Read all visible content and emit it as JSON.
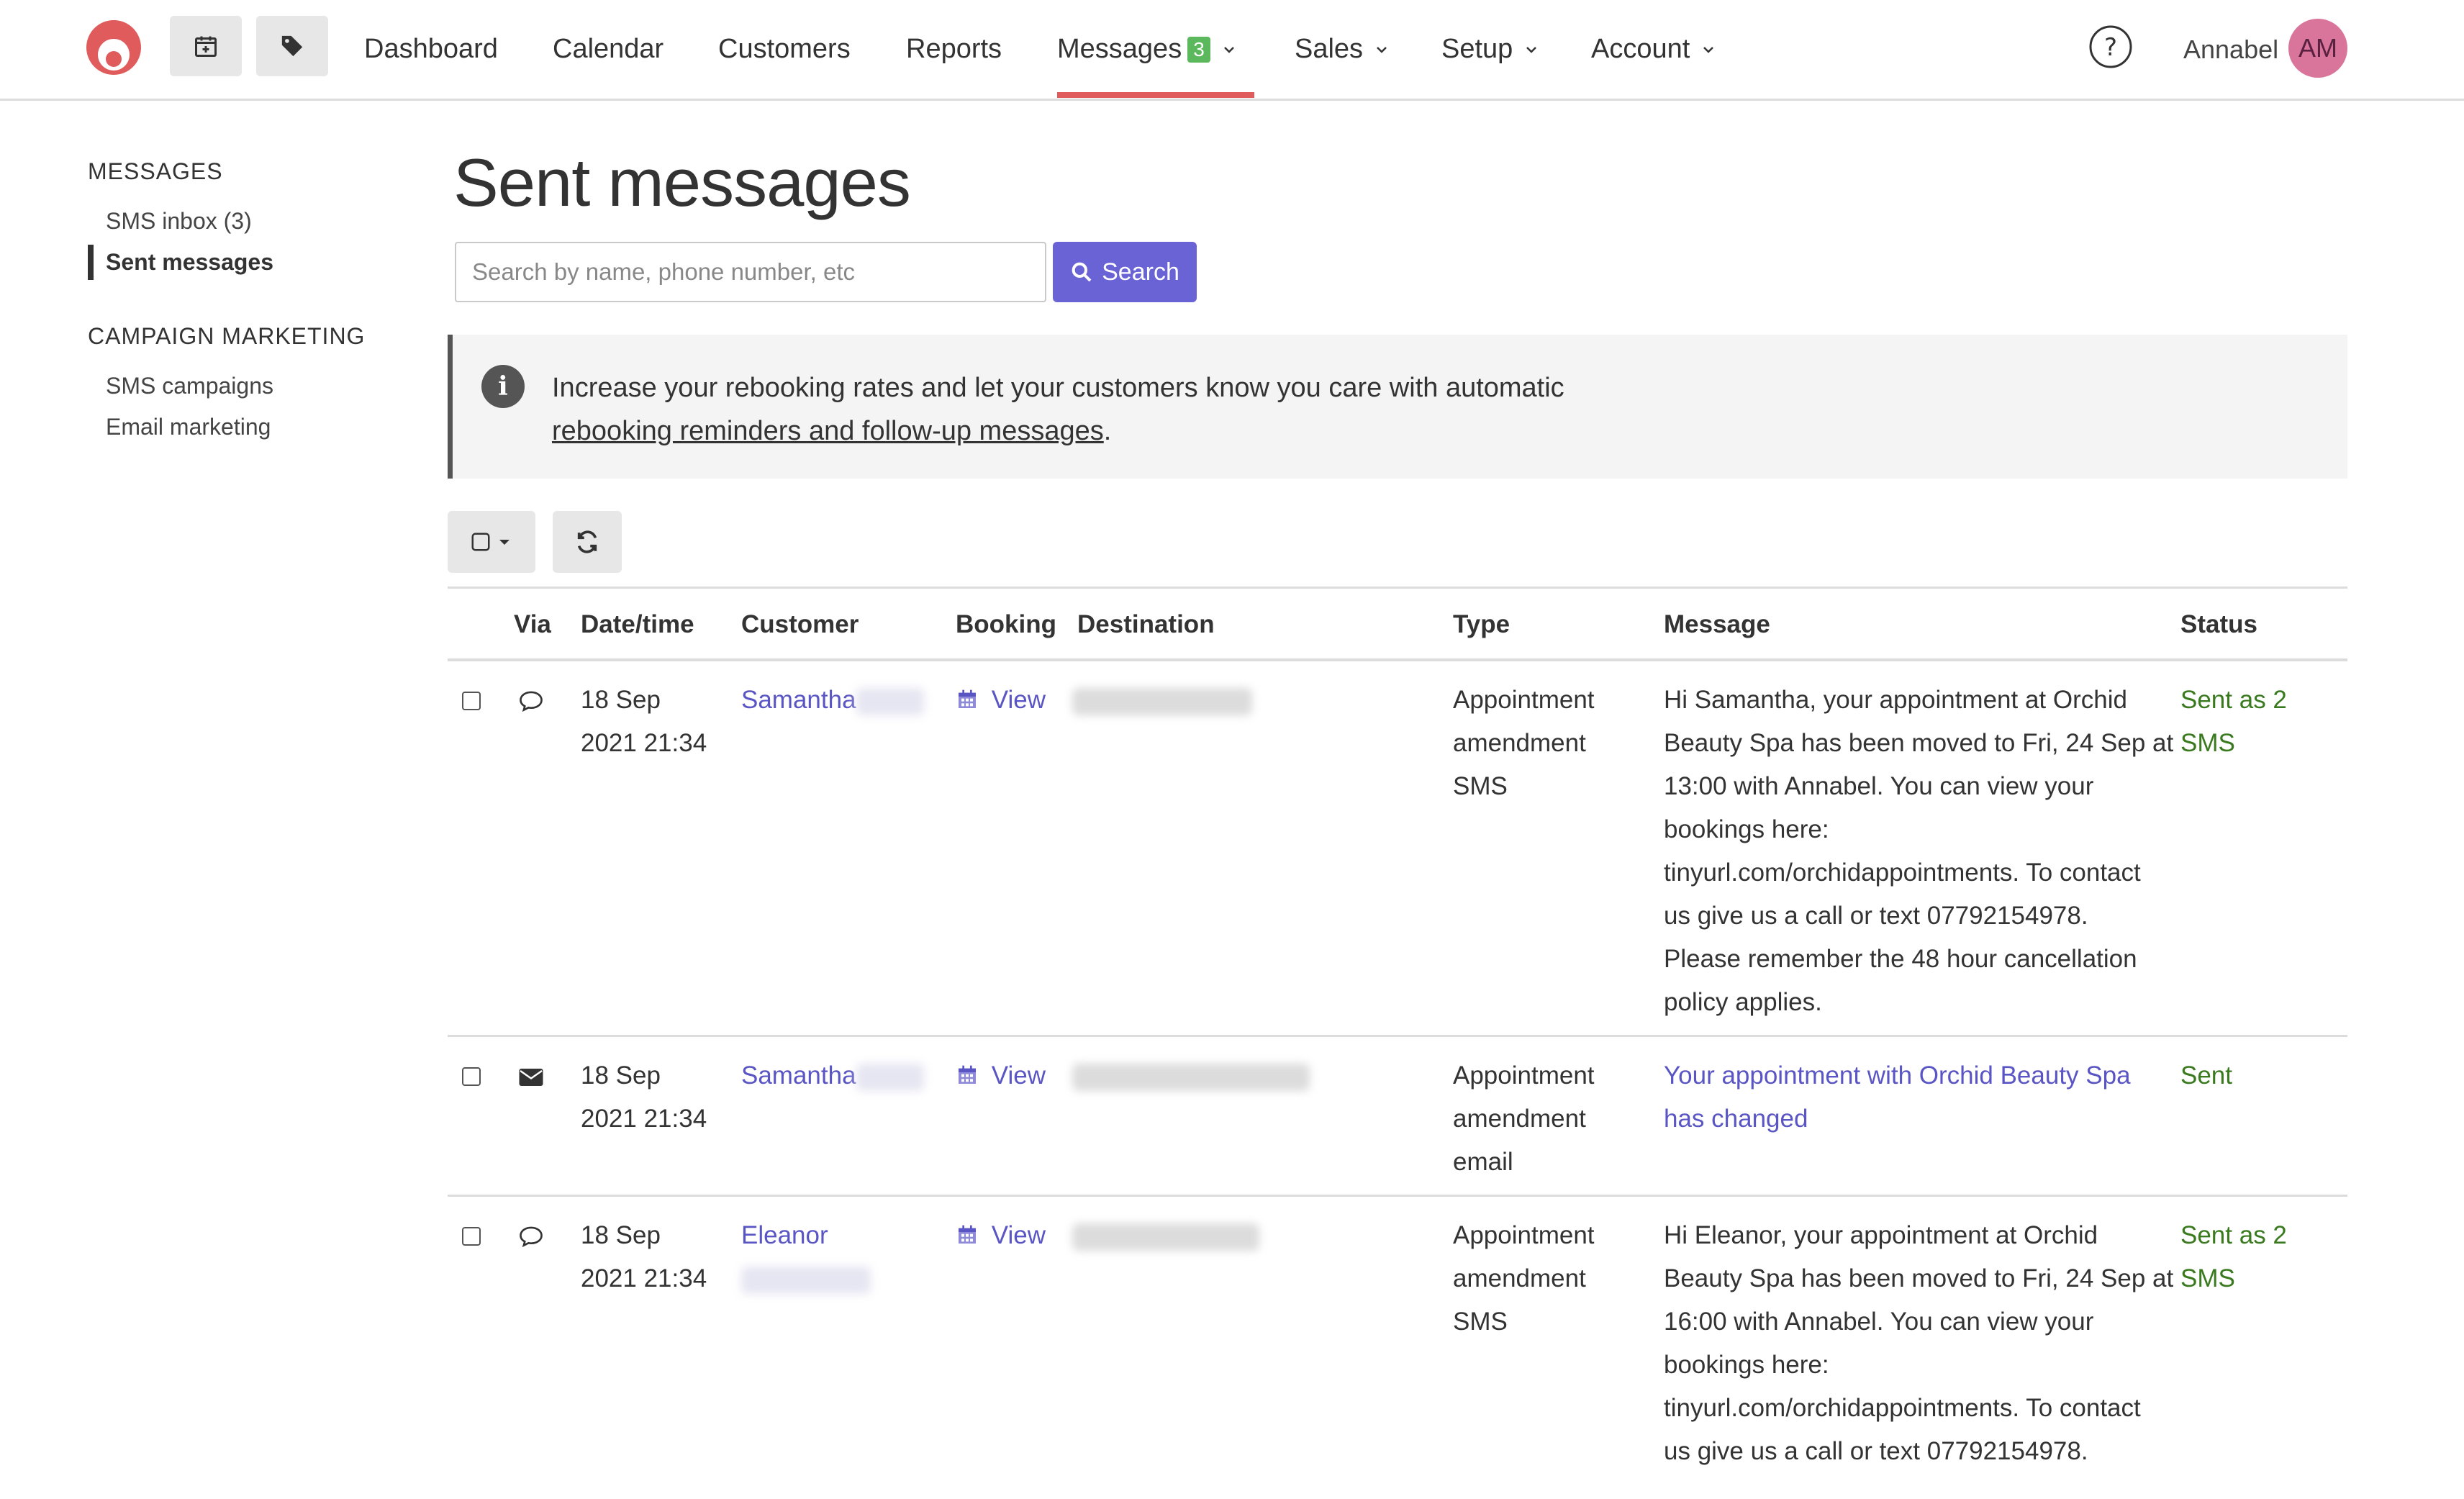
{
  "topnav": {
    "items": [
      {
        "label": "Dashboard"
      },
      {
        "label": "Calendar"
      },
      {
        "label": "Customers"
      },
      {
        "label": "Reports"
      },
      {
        "label": "Messages",
        "badge": "3"
      },
      {
        "label": "Sales"
      },
      {
        "label": "Setup"
      },
      {
        "label": "Account"
      }
    ],
    "user_name": "Annabel",
    "avatar_initials": "AM",
    "accent_color": "#e05b5b"
  },
  "sidebar": {
    "section1": "MESSAGES",
    "items1": [
      "SMS inbox (3)",
      "Sent messages"
    ],
    "section2": "CAMPAIGN MARKETING",
    "items2": [
      "SMS campaigns",
      "Email marketing"
    ]
  },
  "main": {
    "title": "Sent messages",
    "search_placeholder": "Search by name, phone number, etc",
    "search_button": "Search",
    "info_text": "Increase your rebooking rates and let your customers know you care with automatic",
    "info_link": "rebooking reminders and follow-up messages",
    "info_suffix": "."
  },
  "table": {
    "headers": [
      "Via",
      "Date/time",
      "Customer",
      "Booking",
      "Destination",
      "Type",
      "Message",
      "Status"
    ],
    "rows": [
      {
        "via": "sms",
        "date": "18 Sep",
        "time": "2021 21:34",
        "customer": "Samantha",
        "booking": "View",
        "type": [
          "Appointment",
          "amendment",
          "SMS"
        ],
        "message": [
          "Hi Samantha, your appointment at Orchid",
          "Beauty Spa has been moved to Fri, 24 Sep at",
          "13:00 with Annabel. You can view your",
          "bookings here:",
          "tinyurl.com/orchidappointments. To contact",
          "us give us a call or text 07792154978.",
          "Please remember the 48 hour cancellation",
          "policy applies."
        ],
        "status": "Sent as 2 SMS"
      },
      {
        "via": "email",
        "date": "18 Sep",
        "time": "2021 21:34",
        "customer": "Samantha",
        "booking": "View",
        "type": [
          "Appointment",
          "amendment",
          "email"
        ],
        "message_link": [
          "Your appointment with Orchid Beauty Spa",
          "has changed"
        ],
        "status": "Sent"
      },
      {
        "via": "sms",
        "date": "18 Sep",
        "time": "2021 21:34",
        "customer": "Eleanor",
        "booking": "View",
        "type": [
          "Appointment",
          "amendment",
          "SMS"
        ],
        "message": [
          "Hi Eleanor, your appointment at Orchid",
          "Beauty Spa has been moved to Fri, 24 Sep at",
          "16:00 with Annabel. You can view your",
          "bookings here:",
          "tinyurl.com/orchidappointments. To contact",
          "us give us a call or text 07792154978."
        ],
        "status": "Sent as 2 SMS"
      }
    ]
  }
}
